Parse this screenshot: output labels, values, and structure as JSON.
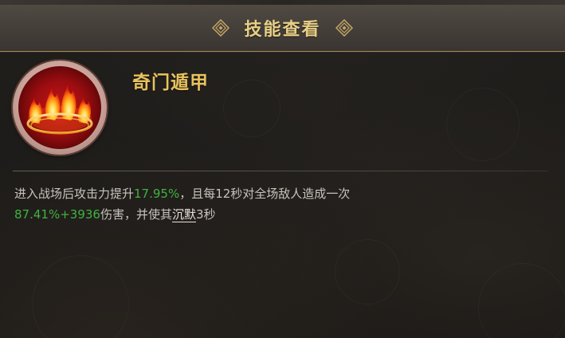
{
  "header": {
    "title": "技能查看",
    "left_icon": "diamond-ornament-icon",
    "right_icon": "diamond-ornament-icon"
  },
  "skill": {
    "icon": "flame-ring-icon",
    "name": "奇门遁甲",
    "description": {
      "line1_part1": "进入战场后攻击力提升",
      "line1_value": "17.95%",
      "line1_part2": "，且每12秒对全场敌人造成一次",
      "line2_value": "87.41%+3936",
      "line2_part1": "伤害，并使其",
      "line2_keyword": "沉默",
      "line2_part2": "3秒"
    }
  },
  "colors": {
    "title": "#e8cf86",
    "skill_name": "#e8c25d",
    "highlight": "#3fb33f",
    "body_text": "#c8c3bc",
    "gold_border": "#a9884f"
  }
}
